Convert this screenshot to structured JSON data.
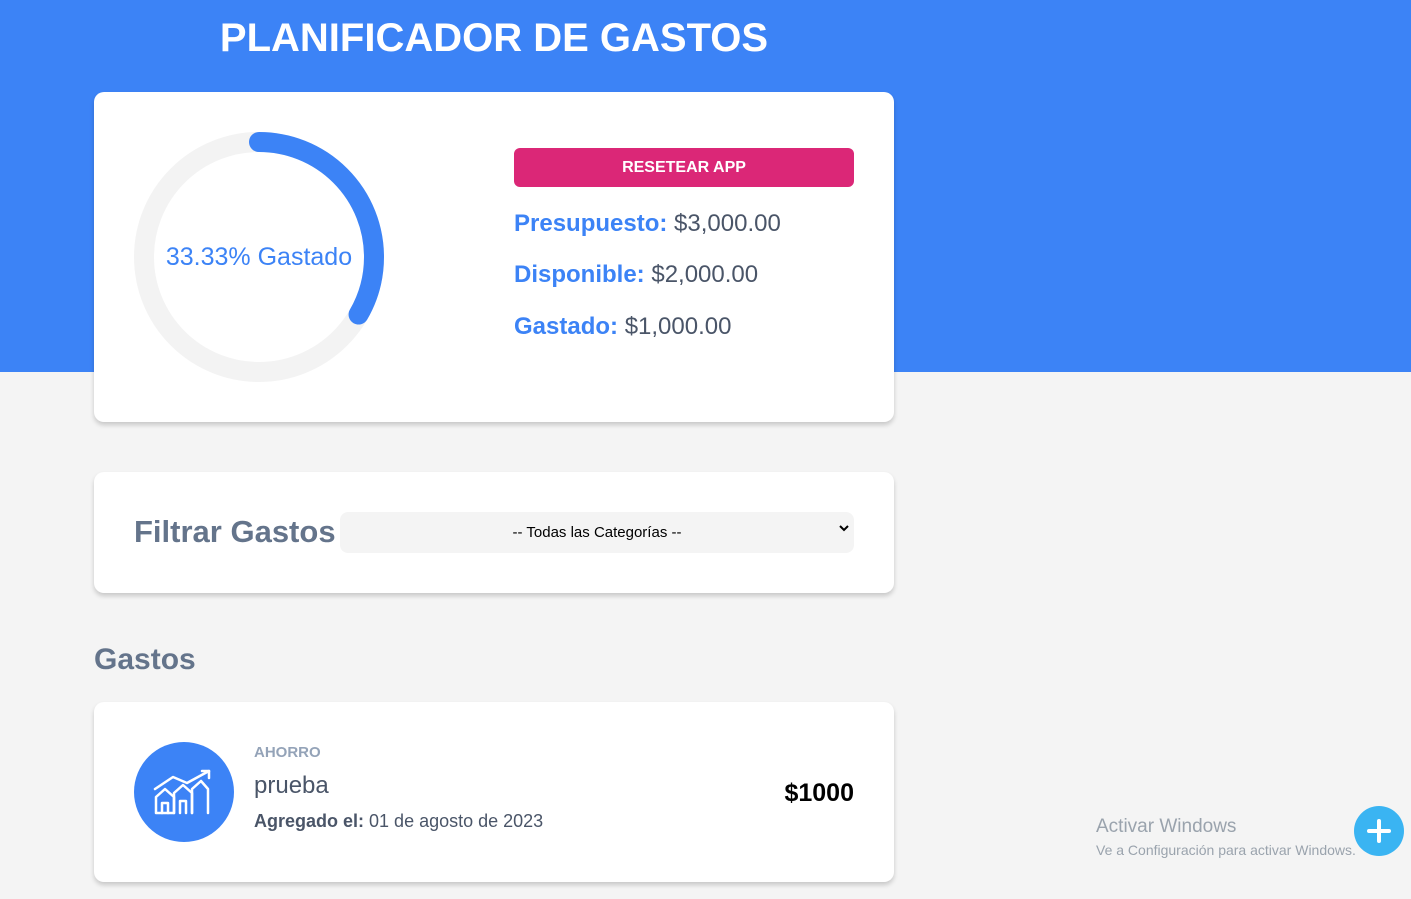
{
  "app": {
    "title": "PLANIFICADOR DE GASTOS"
  },
  "budget": {
    "progress_percent": 33.33,
    "progress_label": "33.33% Gastado",
    "reset_label": "RESETEAR APP",
    "presupuesto_label": "Presupuesto:",
    "presupuesto_value": "$3,000.00",
    "disponible_label": "Disponible:",
    "disponible_value": "$2,000.00",
    "gastado_label": "Gastado:",
    "gastado_value": "$1,000.00"
  },
  "filter": {
    "label": "Filtrar Gastos",
    "selected": "-- Todas las Categorías --"
  },
  "expenses": {
    "title": "Gastos",
    "items": [
      {
        "category": "AHORRO",
        "category_icon": "savings-chart-icon",
        "name": "prueba",
        "date_label": "Agregado el:",
        "date": "01 de agosto de 2023",
        "amount": "$1000"
      }
    ]
  },
  "watermark": {
    "line1": "Activar Windows",
    "line2": "Ve a Configuración para activar Windows."
  },
  "colors": {
    "primary": "#3c83f6",
    "reset_button": "#db2777",
    "background": "#f4f4f4",
    "fab": "#3ab4f2"
  }
}
